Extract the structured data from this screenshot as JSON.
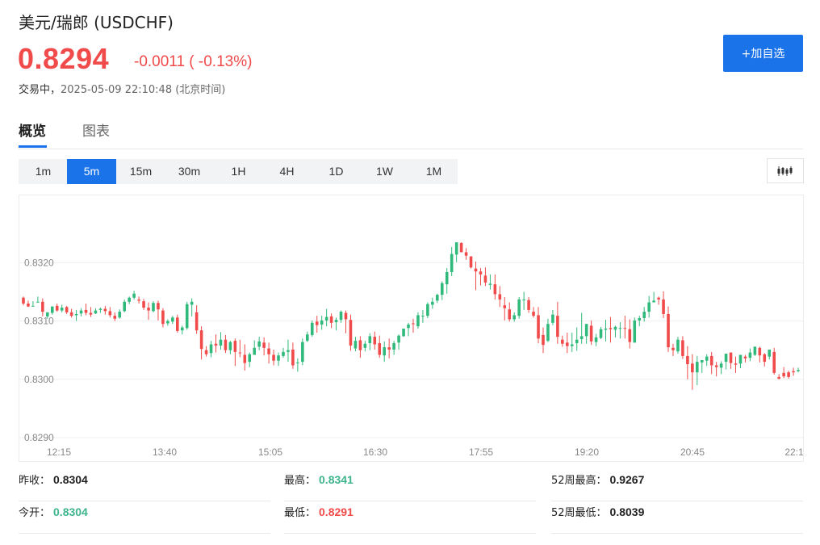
{
  "header": {
    "title": "美元/瑞郎  (USDCHF)",
    "price": "0.8294",
    "change": "-0.0011 ( -0.13%)",
    "status_label": "交易中，",
    "timestamp": "2025-05-09 22:10:48",
    "timezone": "(北京时间)",
    "add_button": "+加自选"
  },
  "tabs": [
    {
      "label": "概览",
      "active": true
    },
    {
      "label": "图表",
      "active": false
    }
  ],
  "periods": [
    {
      "label": "1m",
      "active": false
    },
    {
      "label": "5m",
      "active": true
    },
    {
      "label": "15m",
      "active": false
    },
    {
      "label": "30m",
      "active": false
    },
    {
      "label": "1H",
      "active": false
    },
    {
      "label": "4H",
      "active": false
    },
    {
      "label": "1D",
      "active": false
    },
    {
      "label": "1W",
      "active": false
    },
    {
      "label": "1M",
      "active": false
    }
  ],
  "chart_data": {
    "type": "candlestick",
    "y_ticks": [
      "0.8320",
      "0.8310",
      "0.8300",
      "0.8290"
    ],
    "ylim": [
      0.829,
      0.8331
    ],
    "x_ticks": [
      "12:15",
      "13:40",
      "15:05",
      "16:30",
      "17:55",
      "19:20",
      "20:45",
      "22:1"
    ],
    "up_color": "#2fb97a",
    "down_color": "#f04a4a",
    "candles": [
      [
        0.8314,
        0.83142,
        0.8313,
        0.83127
      ],
      [
        0.8313,
        0.83135,
        0.83125,
        0.83124
      ],
      [
        0.83126,
        0.83134,
        0.83126,
        0.83132
      ],
      [
        0.83132,
        0.83142,
        0.83133,
        0.83133
      ],
      [
        0.83133,
        0.83139,
        0.83116,
        0.83108
      ],
      [
        0.83108,
        0.83115,
        0.83115,
        0.83104
      ],
      [
        0.83114,
        0.83125,
        0.83125,
        0.83111
      ],
      [
        0.83126,
        0.8313,
        0.83118,
        0.83116
      ],
      [
        0.83118,
        0.83128,
        0.83123,
        0.83115
      ],
      [
        0.83124,
        0.83126,
        0.83115,
        0.83112
      ],
      [
        0.83115,
        0.83121,
        0.83109,
        0.83106
      ],
      [
        0.8311,
        0.83119,
        0.83112,
        0.831
      ],
      [
        0.83113,
        0.83122,
        0.83118,
        0.83108
      ],
      [
        0.83119,
        0.8313,
        0.83114,
        0.8311
      ],
      [
        0.83114,
        0.83124,
        0.83111,
        0.83107
      ],
      [
        0.83113,
        0.83122,
        0.83118,
        0.83112
      ],
      [
        0.83119,
        0.83123,
        0.83121,
        0.83114
      ],
      [
        0.83121,
        0.83126,
        0.83117,
        0.83111
      ],
      [
        0.83117,
        0.83124,
        0.8311,
        0.83106
      ],
      [
        0.83109,
        0.83115,
        0.83104,
        0.831
      ],
      [
        0.83106,
        0.8312,
        0.83116,
        0.83104
      ],
      [
        0.83117,
        0.83137,
        0.83133,
        0.83115
      ],
      [
        0.83133,
        0.83142,
        0.8314,
        0.83129
      ],
      [
        0.8314,
        0.83152,
        0.83147,
        0.83137
      ],
      [
        0.83137,
        0.83142,
        0.83135,
        0.8313
      ],
      [
        0.83134,
        0.83138,
        0.83123,
        0.83119
      ],
      [
        0.83123,
        0.83132,
        0.83118,
        0.83102
      ],
      [
        0.83117,
        0.83134,
        0.83131,
        0.83115
      ],
      [
        0.83131,
        0.83135,
        0.8312,
        0.83101
      ],
      [
        0.83118,
        0.83122,
        0.83095,
        0.83089
      ],
      [
        0.83096,
        0.83103,
        0.831,
        0.83092
      ],
      [
        0.83099,
        0.83109,
        0.83106,
        0.83095
      ],
      [
        0.83106,
        0.83111,
        0.83083,
        0.8308
      ],
      [
        0.83084,
        0.83092,
        0.83089,
        0.83077
      ],
      [
        0.83088,
        0.83133,
        0.83129,
        0.83085
      ],
      [
        0.83128,
        0.83139,
        0.83133,
        0.83108
      ],
      [
        0.83115,
        0.83127,
        0.83084,
        0.83078
      ],
      [
        0.83084,
        0.83091,
        0.83052,
        0.83034
      ],
      [
        0.8305,
        0.83057,
        0.83043,
        0.83039
      ],
      [
        0.83045,
        0.83066,
        0.8306,
        0.83038
      ],
      [
        0.83061,
        0.83077,
        0.83058,
        0.83046
      ],
      [
        0.83058,
        0.83081,
        0.83068,
        0.83051
      ],
      [
        0.83068,
        0.83076,
        0.8305,
        0.83045
      ],
      [
        0.8305,
        0.83066,
        0.83064,
        0.83043
      ],
      [
        0.83066,
        0.8307,
        0.83047,
        0.83023
      ],
      [
        0.83046,
        0.83068,
        0.83045,
        0.83038
      ],
      [
        0.83042,
        0.8306,
        0.83028,
        0.83015
      ],
      [
        0.8303,
        0.83046,
        0.83043,
        0.83021
      ],
      [
        0.83042,
        0.83067,
        0.83054,
        0.83042
      ],
      [
        0.83056,
        0.83073,
        0.83065,
        0.8305
      ],
      [
        0.83063,
        0.83072,
        0.83054,
        0.83041
      ],
      [
        0.83053,
        0.83063,
        0.83043,
        0.83027
      ],
      [
        0.83042,
        0.83051,
        0.83032,
        0.83024
      ],
      [
        0.83032,
        0.83046,
        0.83041,
        0.83023
      ],
      [
        0.8304,
        0.83054,
        0.83047,
        0.83037
      ],
      [
        0.83047,
        0.83068,
        0.8305,
        0.8303
      ],
      [
        0.83051,
        0.83063,
        0.83024,
        0.83018
      ],
      [
        0.83028,
        0.83036,
        0.83029,
        0.83013
      ],
      [
        0.8303,
        0.8307,
        0.83064,
        0.83024
      ],
      [
        0.83066,
        0.83082,
        0.83077,
        0.83064
      ],
      [
        0.83076,
        0.83101,
        0.83097,
        0.83073
      ],
      [
        0.83099,
        0.83109,
        0.83093,
        0.8308
      ],
      [
        0.83094,
        0.83109,
        0.83101,
        0.83085
      ],
      [
        0.83101,
        0.83121,
        0.83107,
        0.83091
      ],
      [
        0.83108,
        0.83113,
        0.83097,
        0.83088
      ],
      [
        0.83098,
        0.83106,
        0.83102,
        0.83084
      ],
      [
        0.83102,
        0.83118,
        0.83116,
        0.83097
      ],
      [
        0.83114,
        0.83118,
        0.83103,
        0.83079
      ],
      [
        0.83102,
        0.83111,
        0.83058,
        0.83049
      ],
      [
        0.83053,
        0.83073,
        0.83066,
        0.83048
      ],
      [
        0.83067,
        0.83074,
        0.8305,
        0.83037
      ],
      [
        0.83054,
        0.83066,
        0.83061,
        0.83048
      ],
      [
        0.83062,
        0.83079,
        0.83074,
        0.8305
      ],
      [
        0.83073,
        0.83082,
        0.8306,
        0.83051
      ],
      [
        0.83062,
        0.83075,
        0.83042,
        0.83037
      ],
      [
        0.83041,
        0.83065,
        0.83055,
        0.8303
      ],
      [
        0.83055,
        0.8307,
        0.83051,
        0.83036
      ],
      [
        0.83051,
        0.83066,
        0.83062,
        0.83042
      ],
      [
        0.83063,
        0.83077,
        0.83075,
        0.83051
      ],
      [
        0.83074,
        0.83087,
        0.83087,
        0.83073
      ],
      [
        0.83088,
        0.83097,
        0.83094,
        0.83074
      ],
      [
        0.83096,
        0.83104,
        0.83095,
        0.8308
      ],
      [
        0.83091,
        0.83115,
        0.8311,
        0.83087
      ],
      [
        0.83108,
        0.83119,
        0.83109,
        0.83097
      ],
      [
        0.83109,
        0.83132,
        0.83129,
        0.83105
      ],
      [
        0.83128,
        0.8314,
        0.83133,
        0.83121
      ],
      [
        0.83135,
        0.83147,
        0.83145,
        0.83131
      ],
      [
        0.83145,
        0.83168,
        0.83165,
        0.83136
      ],
      [
        0.83163,
        0.83191,
        0.83184,
        0.83147
      ],
      [
        0.83184,
        0.83227,
        0.83215,
        0.83177
      ],
      [
        0.83214,
        0.83233,
        0.83235,
        0.83201
      ],
      [
        0.83234,
        0.83235,
        0.83218,
        0.83218
      ],
      [
        0.83218,
        0.83225,
        0.83212,
        0.83205
      ],
      [
        0.83211,
        0.83211,
        0.83192,
        0.8319
      ],
      [
        0.8319,
        0.83202,
        0.83185,
        0.83153
      ],
      [
        0.83185,
        0.83191,
        0.8318,
        0.83161
      ],
      [
        0.83178,
        0.83192,
        0.83166,
        0.8316
      ],
      [
        0.83162,
        0.8318,
        0.83164,
        0.83154
      ],
      [
        0.83163,
        0.8318,
        0.83146,
        0.83137
      ],
      [
        0.83146,
        0.8316,
        0.83137,
        0.83124
      ],
      [
        0.83127,
        0.83141,
        0.83122,
        0.83101
      ],
      [
        0.8312,
        0.83132,
        0.83103,
        0.83099
      ],
      [
        0.83103,
        0.83115,
        0.8311,
        0.83099
      ],
      [
        0.83109,
        0.83141,
        0.83137,
        0.83104
      ],
      [
        0.83137,
        0.8315,
        0.83137,
        0.83119
      ],
      [
        0.83136,
        0.83141,
        0.83119,
        0.83114
      ],
      [
        0.83116,
        0.83124,
        0.83109,
        0.83106
      ],
      [
        0.8311,
        0.83124,
        0.8307,
        0.83062
      ],
      [
        0.83076,
        0.83089,
        0.83059,
        0.83045
      ],
      [
        0.83066,
        0.83104,
        0.83095,
        0.83064
      ],
      [
        0.83097,
        0.83119,
        0.83111,
        0.83093
      ],
      [
        0.83109,
        0.83133,
        0.83073,
        0.83061
      ],
      [
        0.83068,
        0.83075,
        0.83061,
        0.83056
      ],
      [
        0.83063,
        0.8308,
        0.83057,
        0.83045
      ],
      [
        0.83057,
        0.8308,
        0.8306,
        0.83047
      ],
      [
        0.83062,
        0.83089,
        0.83068,
        0.83049
      ],
      [
        0.83069,
        0.83114,
        0.83074,
        0.83061
      ],
      [
        0.83074,
        0.83088,
        0.83095,
        0.83061
      ],
      [
        0.83092,
        0.83101,
        0.83065,
        0.83059
      ],
      [
        0.83064,
        0.83078,
        0.83072,
        0.83057
      ],
      [
        0.83071,
        0.8309,
        0.83086,
        0.83069
      ],
      [
        0.83085,
        0.83102,
        0.83087,
        0.83065
      ],
      [
        0.83088,
        0.83107,
        0.83086,
        0.83063
      ],
      [
        0.83085,
        0.83092,
        0.8309,
        0.83072
      ],
      [
        0.83088,
        0.83098,
        0.83088,
        0.8307
      ],
      [
        0.83088,
        0.83109,
        0.83087,
        0.8307
      ],
      [
        0.83086,
        0.83103,
        0.83064,
        0.83053
      ],
      [
        0.83063,
        0.83106,
        0.83101,
        0.83063
      ],
      [
        0.83101,
        0.83109,
        0.83105,
        0.83091
      ],
      [
        0.83105,
        0.83124,
        0.83116,
        0.83099
      ],
      [
        0.83116,
        0.83143,
        0.83132,
        0.83106
      ],
      [
        0.83132,
        0.8315,
        0.83135,
        0.83132
      ],
      [
        0.8314,
        0.83142,
        0.83137,
        0.83128
      ],
      [
        0.83137,
        0.83151,
        0.83112,
        0.83105
      ],
      [
        0.83112,
        0.83125,
        0.83055,
        0.83047
      ],
      [
        0.83054,
        0.83061,
        0.8305,
        0.8304
      ],
      [
        0.83048,
        0.83073,
        0.83068,
        0.83044
      ],
      [
        0.83067,
        0.83074,
        0.8304,
        0.83035
      ],
      [
        0.8304,
        0.83057,
        0.83026,
        0.83
      ],
      [
        0.83027,
        0.83043,
        0.83012,
        0.82982
      ],
      [
        0.83012,
        0.8304,
        0.8303,
        0.8299
      ],
      [
        0.83029,
        0.83032,
        0.83033,
        0.83011
      ],
      [
        0.83032,
        0.83043,
        0.83039,
        0.83023
      ],
      [
        0.8304,
        0.83047,
        0.83024,
        0.83009
      ],
      [
        0.83024,
        0.8303,
        0.83021,
        0.83005
      ],
      [
        0.8302,
        0.83031,
        0.83027,
        0.83009
      ],
      [
        0.8303,
        0.8304,
        0.83044,
        0.83017
      ],
      [
        0.83046,
        0.83046,
        0.83028,
        0.83018
      ],
      [
        0.83027,
        0.83039,
        0.83025,
        0.83011
      ],
      [
        0.83027,
        0.83037,
        0.83042,
        0.83019
      ],
      [
        0.83039,
        0.83042,
        0.83036,
        0.83029
      ],
      [
        0.83037,
        0.83053,
        0.83046,
        0.83031
      ],
      [
        0.83042,
        0.83053,
        0.83056,
        0.8304
      ],
      [
        0.83054,
        0.83056,
        0.83041,
        0.83029
      ],
      [
        0.83043,
        0.83045,
        0.8303,
        0.83022
      ],
      [
        0.83039,
        0.83042,
        0.83051,
        0.83034
      ],
      [
        0.83047,
        0.83054,
        0.83011,
        0.83008
      ],
      [
        0.83004,
        0.83009,
        0.83001,
        0.83
      ],
      [
        0.83011,
        0.83021,
        0.83005,
        0.83002
      ],
      [
        0.83012,
        0.83015,
        0.83004,
        0.83001
      ],
      [
        0.83014,
        0.8302,
        0.83012,
        0.83006
      ],
      [
        0.83014,
        0.8302,
        0.83016,
        0.83012
      ]
    ]
  },
  "stats": {
    "prev_close_label": "昨收：",
    "prev_close_value": "0.8304",
    "high_label": "最高：",
    "high_value": "0.8341",
    "week52_high_label": "52周最高：",
    "week52_high_value": "0.9267",
    "open_label": "今开：",
    "open_value": "0.8304",
    "low_label": "最低：",
    "low_value": "0.8291",
    "week52_low_label": "52周最低：",
    "week52_low_value": "0.8039"
  }
}
